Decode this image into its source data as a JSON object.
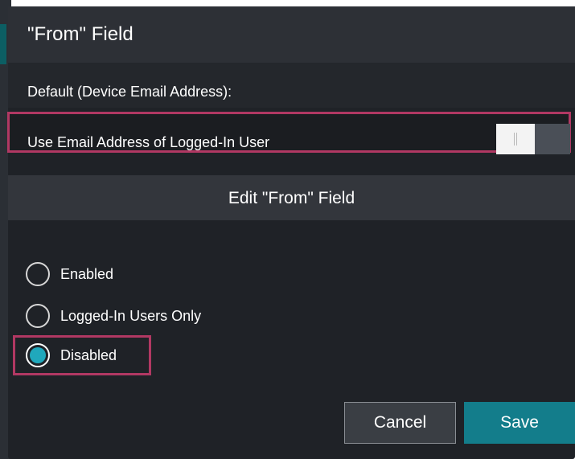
{
  "dialog": {
    "title": "\"From\" Field",
    "default_label": "Default (Device Email Address):",
    "toggle": {
      "label": "Use Email Address of Logged-In User",
      "state": "off"
    },
    "section_title": "Edit \"From\" Field",
    "radio_options": [
      {
        "label": "Enabled",
        "selected": false
      },
      {
        "label": "Logged-In Users Only",
        "selected": false
      },
      {
        "label": "Disabled",
        "selected": true
      }
    ],
    "buttons": {
      "cancel": "Cancel",
      "save": "Save"
    }
  },
  "colors": {
    "dialog_bg": "#1f2227",
    "highlight": "#b13863",
    "accent": "#20a8bc",
    "save_button": "#137d8b"
  }
}
